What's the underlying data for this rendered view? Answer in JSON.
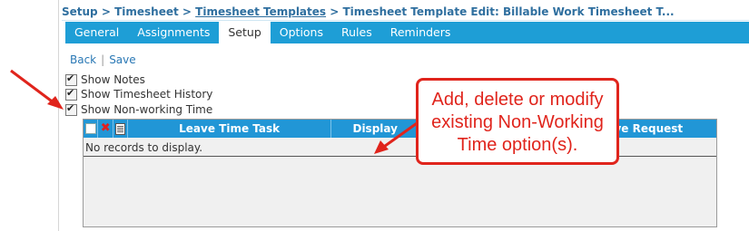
{
  "breadcrumb": {
    "setup": "Setup",
    "sep1": ">",
    "timesheet": "Timesheet",
    "sep2": ">",
    "templates": "Timesheet Templates",
    "sep3": ">",
    "current": "Timesheet Template Edit: Billable Work Timesheet T..."
  },
  "tabs": [
    {
      "label": "General"
    },
    {
      "label": "Assignments"
    },
    {
      "label": "Setup",
      "active": true
    },
    {
      "label": "Options"
    },
    {
      "label": "Rules"
    },
    {
      "label": "Reminders"
    }
  ],
  "actions": {
    "back": "Back",
    "separator": "|",
    "save": "Save"
  },
  "options": [
    {
      "label": "Show Notes",
      "checked": true
    },
    {
      "label": "Show Timesheet History",
      "checked": true
    },
    {
      "label": "Show Non-working Time",
      "checked": true
    }
  ],
  "grid": {
    "columns": [
      "Leave Time Task",
      "Display",
      "Leave Request"
    ],
    "empty_message": "No records to display."
  },
  "callout": {
    "line1": "Add, delete or modify",
    "line2": "existing Non-Working",
    "line3": "Time option(s).",
    "color": "#e0241c"
  },
  "colors": {
    "tab_bar": "#1e9ed6",
    "grid_header": "#2196d6",
    "link": "#2a78b5"
  }
}
